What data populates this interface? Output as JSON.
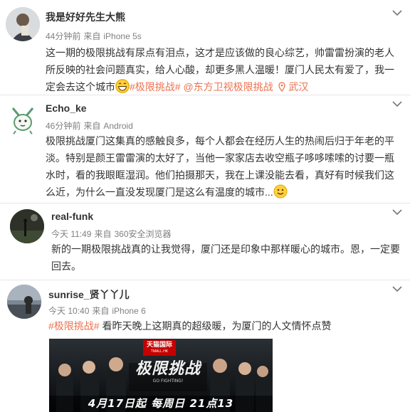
{
  "posts": [
    {
      "name": "我是好好先生大熊",
      "time": "44分钟前",
      "source_prefix": "来自",
      "source": "iPhone 5s",
      "text_line1": "这一期的极限挑战有尿点有泪点，这才是应该做的良心综艺，帅雷雷扮演的老人",
      "text_line2": "所反映的社会问题真实，给人心酸，却更多黑人温暖！厦门人民太有爱了，我一",
      "text_line3_start": "定会去这个城市",
      "hashtag": "#极限挑战#",
      "mention": "@东方卫视极限挑战",
      "location": "武汉"
    },
    {
      "name": "Echo_ke",
      "time": "46分钟前",
      "source_prefix": "来自",
      "source": "Android",
      "text_lines": [
        "极限挑战厦门这集真的感触良多，每个人都会在经历人生的热闹后归于年老的平",
        "淡。特别是颜王雷雷演的太好了，当他一家家店去收空瓶子哆哆嗦嗦的讨要一瓶",
        "水时，看的我眼眶湿润。他们拍摄那天，我在上课没能去看，真好有时候我们这",
        "么近，为什么一直没发现厦门是这么有温度的城市..."
      ]
    },
    {
      "name": "real-funk",
      "time": "今天 11:49",
      "source_prefix": "来自",
      "source": "360安全浏览器",
      "text_lines": [
        "新的一期极限挑战真的让我觉得，厦门还是印象中那样暖心的城市。恩，一定要",
        "回去。"
      ]
    },
    {
      "name": "sunrise_贤丫丫儿",
      "time": "今天 10:40",
      "source_prefix": "来自",
      "source": "iPhone 6",
      "hashtag": "#极限挑战#",
      "text": " 看昨天晚上这期真的超级暖，为厦门的人文情怀点赞",
      "image": {
        "badge": "天猫国际",
        "badge_sub": "TMALL.HK",
        "logo": "极限挑战",
        "logo_sub": "GO FIGHTING!",
        "air_text": "4月17日起 每周日 21点13"
      }
    }
  ],
  "colors": {
    "accent": "#eb7350",
    "meta": "#808080",
    "text": "#333333"
  },
  "icons": [
    "chevron-down-icon",
    "location-pin-icon",
    "grin-emoji-icon",
    "smile-emoji-icon"
  ]
}
